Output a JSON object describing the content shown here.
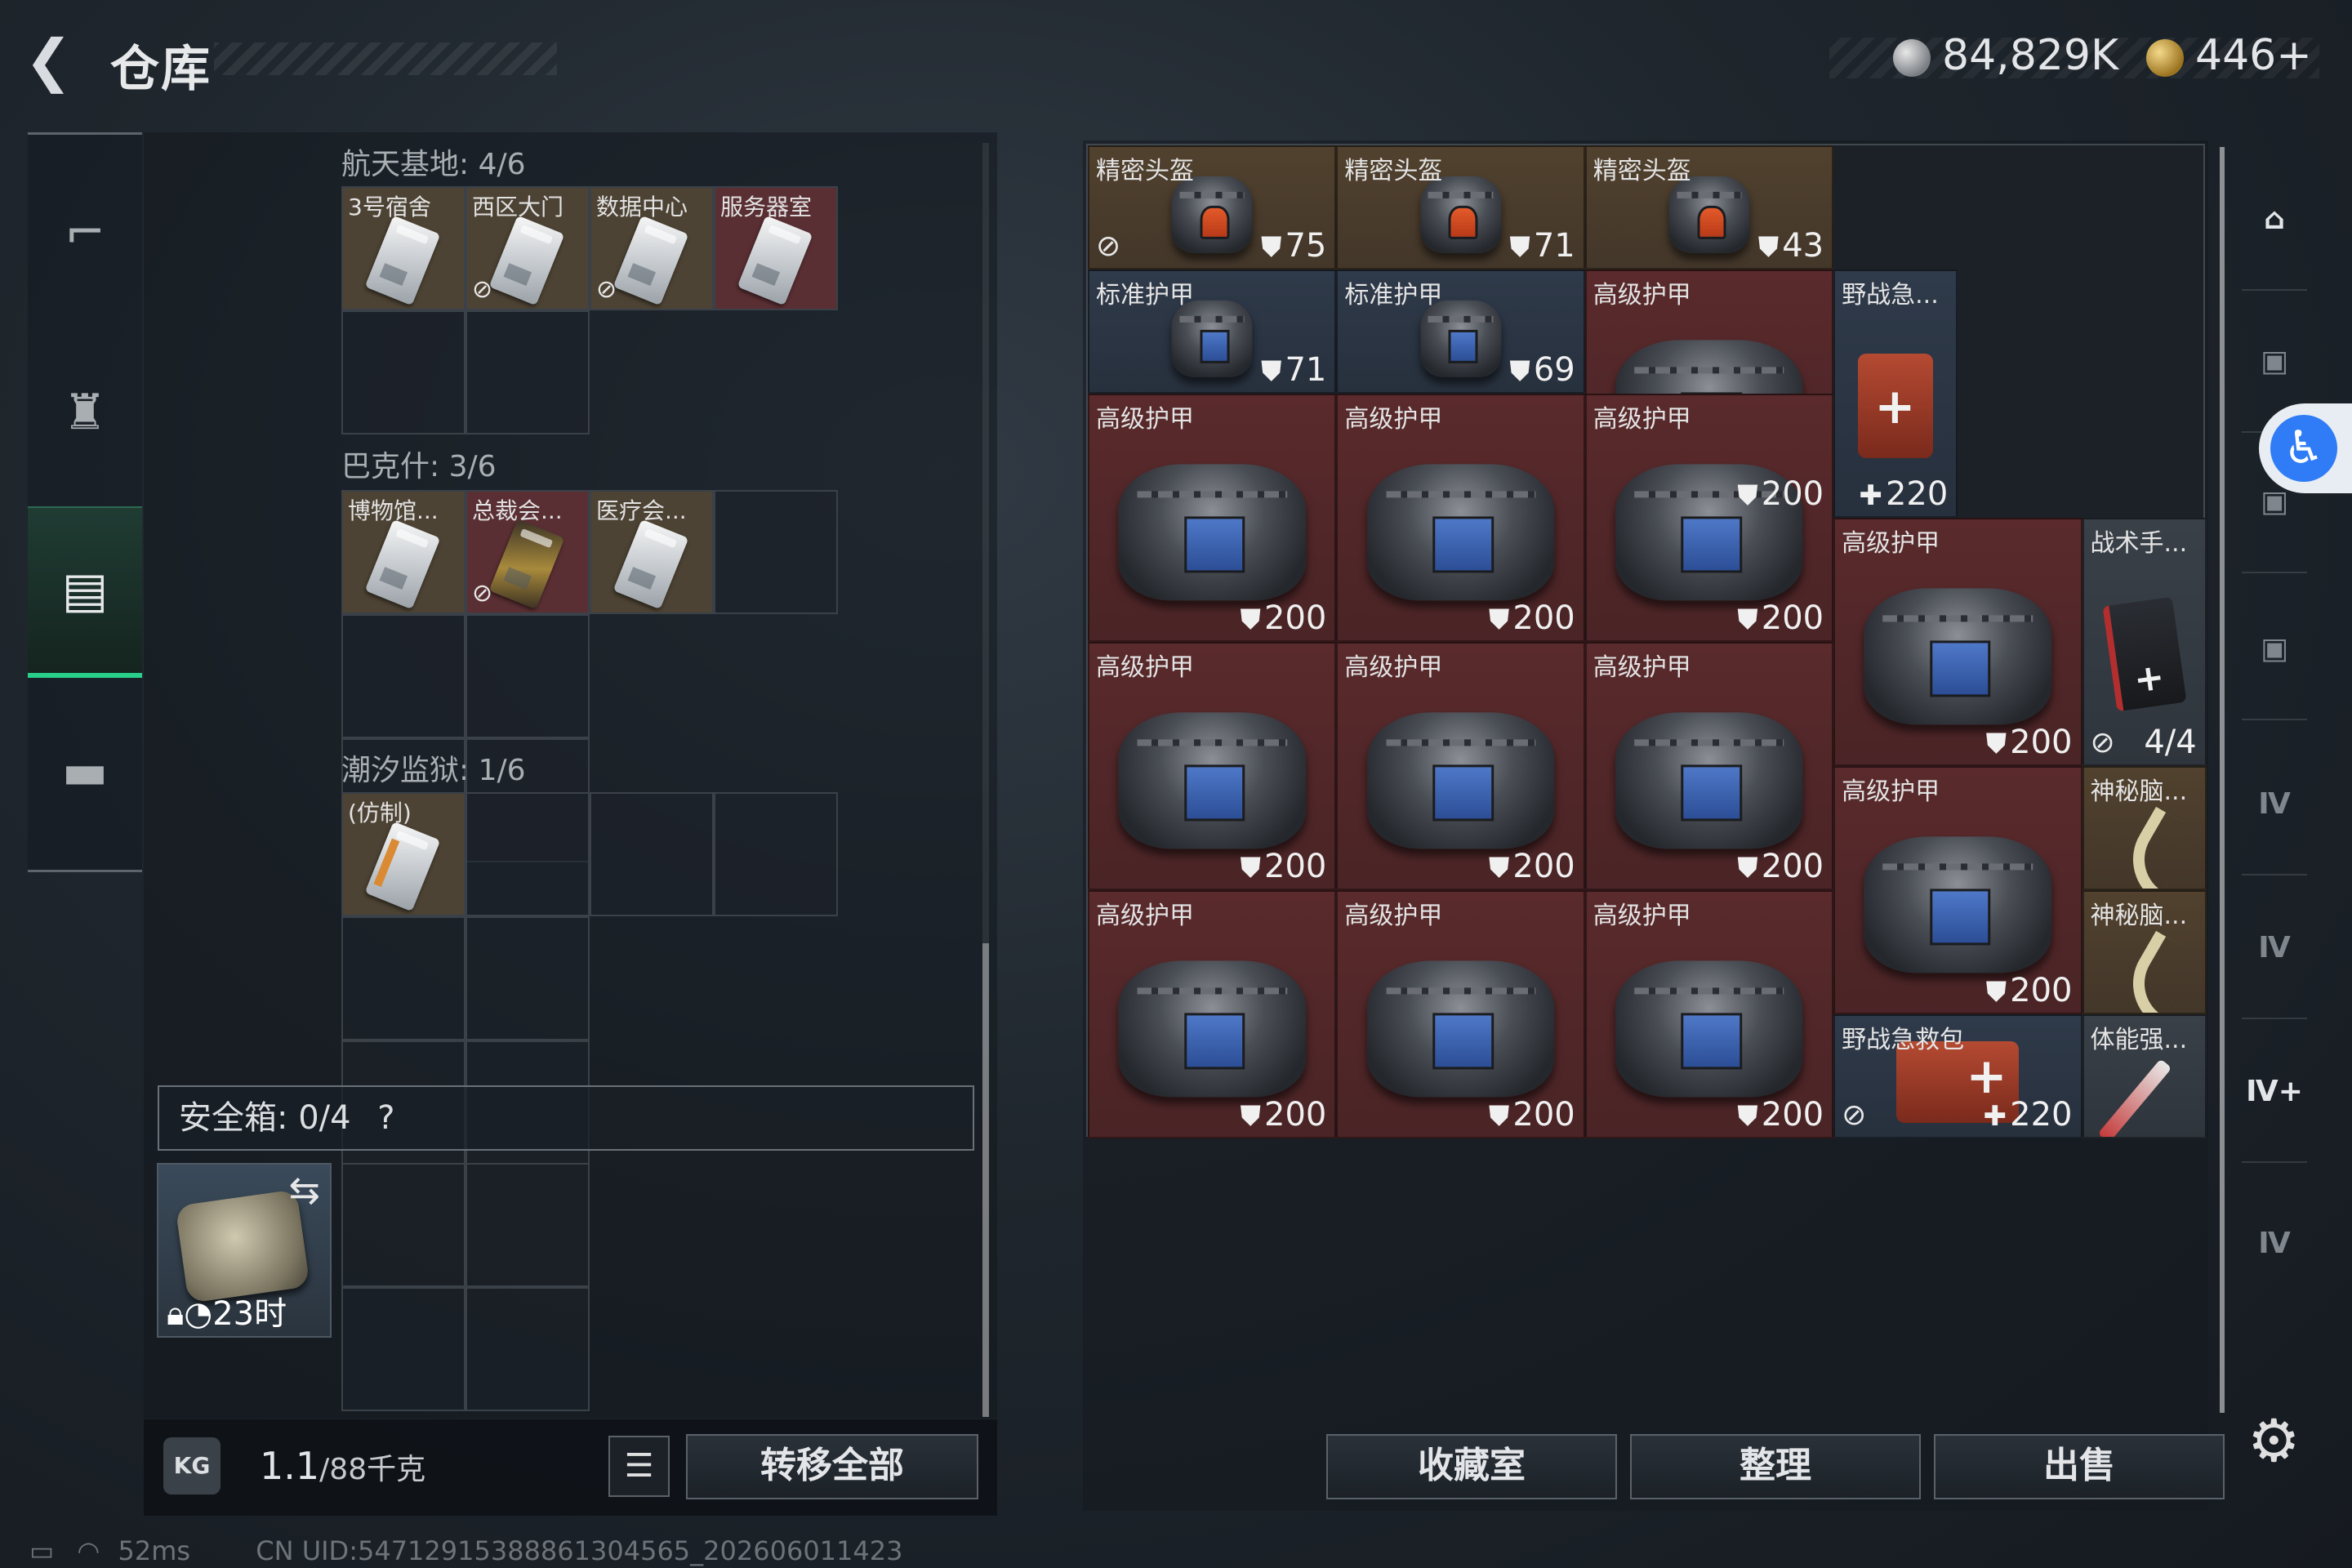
{
  "header": {
    "back_icon": "back-arrow-icon",
    "title": "仓库",
    "currencies": [
      {
        "icon": "silver-coin-icon",
        "value": "84,829K",
        "color": "#c8ccd0"
      },
      {
        "icon": "gold-coin-icon",
        "value": "446+",
        "color": "#d9b45a"
      }
    ]
  },
  "left_nav": [
    {
      "icon": "pistol-icon",
      "active": false
    },
    {
      "icon": "backpack-icon",
      "active": false
    },
    {
      "icon": "keycard-case-icon",
      "active": true
    },
    {
      "icon": "briefcase-icon",
      "active": false
    }
  ],
  "key_sections": [
    {
      "label": "航天基地: 4/6",
      "keys": [
        {
          "name": "3号宿舍",
          "disc": false,
          "style": "silver",
          "bg": "brown"
        },
        {
          "name": "西区大门",
          "disc": true,
          "style": "silver",
          "bg": "brown"
        },
        {
          "name": "数据中心",
          "disc": true,
          "style": "silver",
          "bg": "brown"
        },
        {
          "name": "服务器室",
          "disc": false,
          "style": "silver",
          "bg": "red"
        }
      ]
    },
    {
      "label": "巴克什: 3/6",
      "keys": [
        {
          "name": "博物馆...",
          "disc": false,
          "style": "silver",
          "bg": "brown"
        },
        {
          "name": "总裁会...",
          "disc": true,
          "style": "gold",
          "bg": "red"
        },
        {
          "name": "医疗会...",
          "disc": false,
          "style": "silver",
          "bg": "brown"
        }
      ]
    },
    {
      "label": "潮汐监狱: 1/6",
      "keys": [
        {
          "name": "(仿制)",
          "disc": false,
          "style": "fake",
          "bg": "brown"
        }
      ]
    }
  ],
  "safe": {
    "label": "安全箱: ",
    "count": "0/4",
    "help": "?",
    "timer": "23时"
  },
  "bottom_left": {
    "weight_icon": "KG",
    "weight_value": "1.1",
    "weight_max": "/88千克",
    "transfer_label": "转移全部"
  },
  "stash_items": [
    {
      "name": "精密头盔",
      "kind": "helmet",
      "value": "75",
      "disc": true,
      "bg": "brown",
      "col": 1,
      "row": 1,
      "w": 2,
      "h": 1
    },
    {
      "name": "精密头盔",
      "kind": "helmet",
      "value": "71",
      "disc": false,
      "bg": "brown",
      "col": 3,
      "row": 1,
      "w": 2,
      "h": 1
    },
    {
      "name": "精密头盔",
      "kind": "helmet",
      "value": "43",
      "disc": false,
      "bg": "brown",
      "col": 5,
      "row": 1,
      "w": 2,
      "h": 1
    },
    {
      "name": "标准护甲",
      "kind": "vest-s",
      "value": "71",
      "disc": false,
      "bg": "blue",
      "col": 1,
      "row": 2,
      "w": 2,
      "h": 1
    },
    {
      "name": "标准护甲",
      "kind": "vest-s",
      "value": "69",
      "disc": false,
      "bg": "blue",
      "col": 3,
      "row": 2,
      "w": 2,
      "h": 1
    },
    {
      "name": "高级护甲",
      "kind": "vest",
      "value": "200",
      "disc": false,
      "bg": "red",
      "col": 5,
      "row": 2,
      "w": 2,
      "h": 2
    },
    {
      "name": "野战急...",
      "kind": "medkit",
      "value": "220",
      "disc": false,
      "bg": "blue",
      "col": 7,
      "row": 2,
      "w": 1,
      "h": 2
    },
    {
      "name": "高级护甲",
      "kind": "vest",
      "value": "200",
      "disc": false,
      "bg": "red",
      "col": 1,
      "row": 3,
      "w": 2,
      "h": 2
    },
    {
      "name": "高级护甲",
      "kind": "vest",
      "value": "200",
      "disc": false,
      "bg": "red",
      "col": 3,
      "row": 3,
      "w": 2,
      "h": 2
    },
    {
      "name": "高级护甲",
      "kind": "vest",
      "value": "200",
      "disc": false,
      "bg": "red",
      "col": 5,
      "row": 3,
      "w": 2,
      "h": 2
    },
    {
      "name": "高级护甲",
      "kind": "vest",
      "value": "200",
      "disc": false,
      "bg": "red",
      "col": 7,
      "row": 4,
      "w": 2,
      "h": 2
    },
    {
      "name": "战术手...",
      "kind": "pouch",
      "value": "4/4",
      "disc": true,
      "bg": "gray",
      "col": 9,
      "row": 4,
      "w": 1,
      "h": 2
    },
    {
      "name": "高级护甲",
      "kind": "vest",
      "value": "200",
      "disc": false,
      "bg": "red",
      "col": 1,
      "row": 5,
      "w": 2,
      "h": 2
    },
    {
      "name": "高级护甲",
      "kind": "vest",
      "value": "200",
      "disc": false,
      "bg": "red",
      "col": 3,
      "row": 5,
      "w": 2,
      "h": 2
    },
    {
      "name": "高级护甲",
      "kind": "vest",
      "value": "200",
      "disc": false,
      "bg": "red",
      "col": 5,
      "row": 5,
      "w": 2,
      "h": 2
    },
    {
      "name": "高级护甲",
      "kind": "vest",
      "value": "200",
      "disc": false,
      "bg": "red",
      "col": 7,
      "row": 6,
      "w": 2,
      "h": 2
    },
    {
      "name": "神秘脑...",
      "kind": "curve",
      "value": "",
      "disc": false,
      "bg": "brown",
      "col": 9,
      "row": 6,
      "w": 1,
      "h": 1
    },
    {
      "name": "神秘脑...",
      "kind": "curve",
      "value": "",
      "disc": false,
      "bg": "brown",
      "col": 9,
      "row": 7,
      "w": 1,
      "h": 1
    },
    {
      "name": "高级护甲",
      "kind": "vest",
      "value": "200",
      "disc": false,
      "bg": "red",
      "col": 1,
      "row": 7,
      "w": 2,
      "h": 2
    },
    {
      "name": "高级护甲",
      "kind": "vest",
      "value": "200",
      "disc": false,
      "bg": "red",
      "col": 3,
      "row": 7,
      "w": 2,
      "h": 2
    },
    {
      "name": "高级护甲",
      "kind": "vest",
      "value": "200",
      "disc": false,
      "bg": "red",
      "col": 5,
      "row": 7,
      "w": 2,
      "h": 2
    },
    {
      "name": "野战急救包",
      "kind": "medkit-wide",
      "value": "220",
      "disc": true,
      "bg": "blue",
      "col": 7,
      "row": 8,
      "w": 2,
      "h": 1
    },
    {
      "name": "体能强...",
      "kind": "syringe",
      "value": "",
      "disc": false,
      "bg": "gray",
      "col": 9,
      "row": 8,
      "w": 1,
      "h": 1
    }
  ],
  "right_rail": [
    {
      "icon": "home-shelf-icon",
      "label": "⌂",
      "bright": true
    },
    {
      "icon": "camera-case-icon",
      "label": "▣",
      "bright": false
    },
    {
      "icon": "camera-case-icon",
      "label": "▣",
      "bright": false
    },
    {
      "icon": "camera-case-icon",
      "label": "▣",
      "bright": false
    },
    {
      "icon": "tier4-case-icon",
      "label": "Ⅳ",
      "bright": false
    },
    {
      "icon": "tier4-folder-icon",
      "label": "Ⅳ",
      "bright": false
    },
    {
      "icon": "tier4-medkit-icon",
      "label": "Ⅳ+",
      "bright": true
    },
    {
      "icon": "tier4-case-icon",
      "label": "Ⅳ",
      "bright": false
    }
  ],
  "bottom_buttons": {
    "collection": "收藏室",
    "sort": "整理",
    "sell": "出售"
  },
  "status": {
    "ping": "52ms",
    "uid": "CN UID:5471291538886130456​5_202606011423"
  }
}
